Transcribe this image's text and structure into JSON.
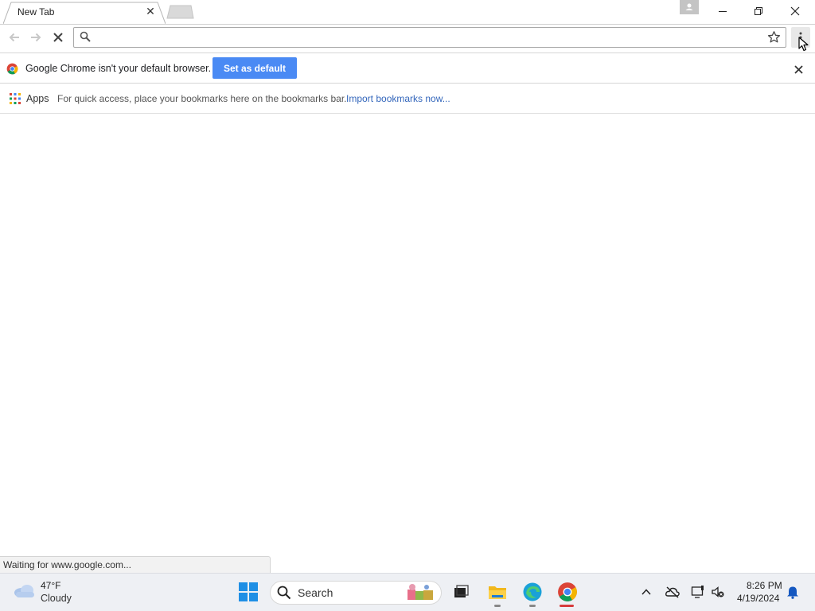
{
  "tab": {
    "title": "New Tab",
    "close_glyph": "✕"
  },
  "window_controls": {
    "minimize": "—",
    "maximize": "❐",
    "close": "✕"
  },
  "omnibox": {
    "value": "",
    "placeholder": ""
  },
  "infobar": {
    "message": "Google Chrome isn't your default browser.",
    "button_label": "Set as default"
  },
  "bookmarks_bar": {
    "apps_label": "Apps",
    "hint": "For quick access, place your bookmarks here on the bookmarks bar.",
    "import_link": "Import bookmarks now..."
  },
  "status": {
    "text": "Waiting for www.google.com..."
  },
  "taskbar": {
    "weather": {
      "temp": "47°F",
      "condition": "Cloudy"
    },
    "search_label": "Search",
    "clock": {
      "time": "8:26 PM",
      "date": "4/19/2024"
    }
  },
  "icons": {
    "back": "back-arrow-icon",
    "forward": "forward-arrow-icon",
    "stop": "stop-loading-icon",
    "search": "search-icon",
    "star": "bookmark-star-icon",
    "menu": "menu-kebab-icon",
    "apps": "apps-grid-icon",
    "chrome": "chrome-logo-icon"
  },
  "colors": {
    "accent_button": "#4a8af4",
    "link": "#3366bb",
    "chrome_running_indicator": "#d63b3b"
  }
}
